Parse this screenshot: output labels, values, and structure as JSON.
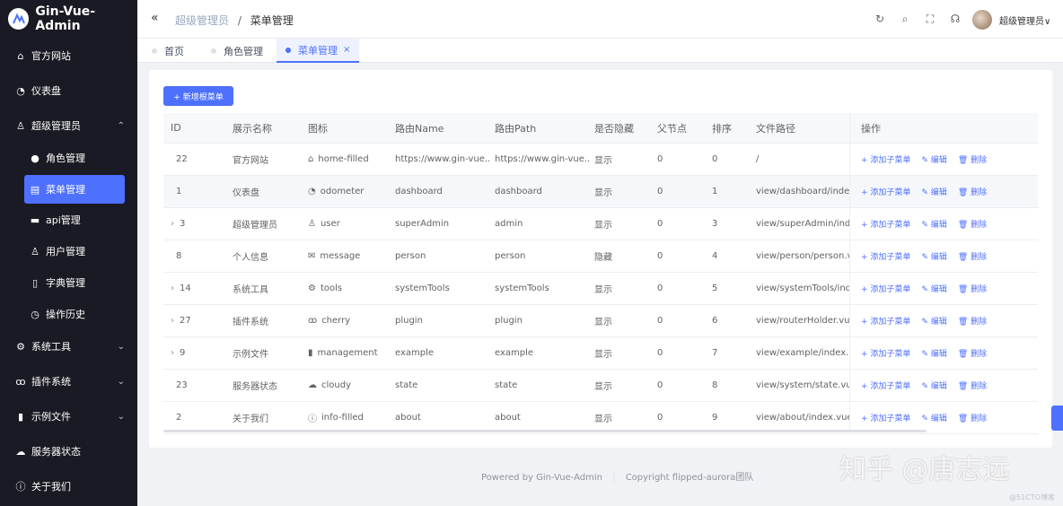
{
  "app": {
    "title": "Gin-Vue-Admin"
  },
  "sidebar": {
    "items": [
      {
        "label": "官方网站",
        "icon": "home-icon"
      },
      {
        "label": "仪表盘",
        "icon": "odometer-icon"
      },
      {
        "label": "超级管理员",
        "icon": "user-icon"
      },
      {
        "label": "系统工具",
        "icon": "tools-icon"
      },
      {
        "label": "插件系统",
        "icon": "cherry-icon"
      },
      {
        "label": "示例文件",
        "icon": "management-icon"
      },
      {
        "label": "服务器状态",
        "icon": "cloudy-icon"
      },
      {
        "label": "关于我们",
        "icon": "info-icon"
      }
    ],
    "subitems": [
      {
        "label": "角色管理",
        "icon": "avatar-icon"
      },
      {
        "label": "菜单管理",
        "icon": "tickets-icon"
      },
      {
        "label": "api管理",
        "icon": "platform-icon"
      },
      {
        "label": "用户管理",
        "icon": "coordinate-icon"
      },
      {
        "label": "字典管理",
        "icon": "notebook-icon"
      },
      {
        "label": "操作历史",
        "icon": "pie-chart-icon"
      }
    ]
  },
  "header": {
    "collapse": "«",
    "breadcrumb": {
      "parent": "超级管理员",
      "sep": "/",
      "current": "菜单管理"
    },
    "user": "超级管理员∨"
  },
  "tabs": [
    {
      "label": "首页"
    },
    {
      "label": "角色管理"
    },
    {
      "label": "菜单管理",
      "close": "×"
    }
  ],
  "toolbar": {
    "add_label": "+ 新增根菜单"
  },
  "table": {
    "headers": [
      "ID",
      "展示名称",
      "图标",
      "路由Name",
      "路由Path",
      "是否隐藏",
      "父节点",
      "排序",
      "文件路径",
      "操作"
    ],
    "ops": {
      "add": "+ 添加子菜单",
      "edit": "✎ 编辑",
      "delete": "🗑 删除"
    },
    "rows": [
      {
        "id": "22",
        "expand": "",
        "name": "官方网站",
        "glyph": "⌂",
        "icon": "home-filled",
        "rname": "https://www.gin-vue...",
        "rpath": "https://www.gin-vue...",
        "hidden": "显示",
        "parent": "0",
        "sort": "0",
        "file": "/"
      },
      {
        "id": "1",
        "expand": "",
        "name": "仪表盘",
        "glyph": "◔",
        "icon": "odometer",
        "rname": "dashboard",
        "rpath": "dashboard",
        "hidden": "显示",
        "parent": "0",
        "sort": "1",
        "file": "view/dashboard/index.vu"
      },
      {
        "id": "3",
        "expand": "›",
        "name": "超级管理员",
        "glyph": "♙",
        "icon": "user",
        "rname": "superAdmin",
        "rpath": "admin",
        "hidden": "显示",
        "parent": "0",
        "sort": "3",
        "file": "view/superAdmin/index.v"
      },
      {
        "id": "8",
        "expand": "",
        "name": "个人信息",
        "glyph": "✉",
        "icon": "message",
        "rname": "person",
        "rpath": "person",
        "hidden": "隐藏",
        "parent": "0",
        "sort": "4",
        "file": "view/person/person.vue"
      },
      {
        "id": "14",
        "expand": "›",
        "name": "系统工具",
        "glyph": "⚙",
        "icon": "tools",
        "rname": "systemTools",
        "rpath": "systemTools",
        "hidden": "显示",
        "parent": "0",
        "sort": "5",
        "file": "view/systemTools/index.v"
      },
      {
        "id": "27",
        "expand": "›",
        "name": "插件系统",
        "glyph": "ꝏ",
        "icon": "cherry",
        "rname": "plugin",
        "rpath": "plugin",
        "hidden": "显示",
        "parent": "0",
        "sort": "6",
        "file": "view/routerHolder.vue"
      },
      {
        "id": "9",
        "expand": "›",
        "name": "示例文件",
        "glyph": "▮",
        "icon": "management",
        "rname": "example",
        "rpath": "example",
        "hidden": "显示",
        "parent": "0",
        "sort": "7",
        "file": "view/example/index.vue"
      },
      {
        "id": "23",
        "expand": "",
        "name": "服务器状态",
        "glyph": "☁",
        "icon": "cloudy",
        "rname": "state",
        "rpath": "state",
        "hidden": "显示",
        "parent": "0",
        "sort": "8",
        "file": "view/system/state.vue"
      },
      {
        "id": "2",
        "expand": "",
        "name": "关于我们",
        "glyph": "ⓘ",
        "icon": "info-filled",
        "rname": "about",
        "rpath": "about",
        "hidden": "显示",
        "parent": "0",
        "sort": "9",
        "file": "view/about/index.vue"
      }
    ]
  },
  "footer": {
    "powered": "Powered by Gin-Vue-Admin",
    "bar": "|",
    "copyright": "Copyright flipped-aurora团队"
  },
  "watermark": {
    "text": "知乎 @唐志远",
    "small": "@51CTO博客"
  },
  "colors": {
    "primary": "#4d70ff",
    "sidebar": "#191a23"
  }
}
